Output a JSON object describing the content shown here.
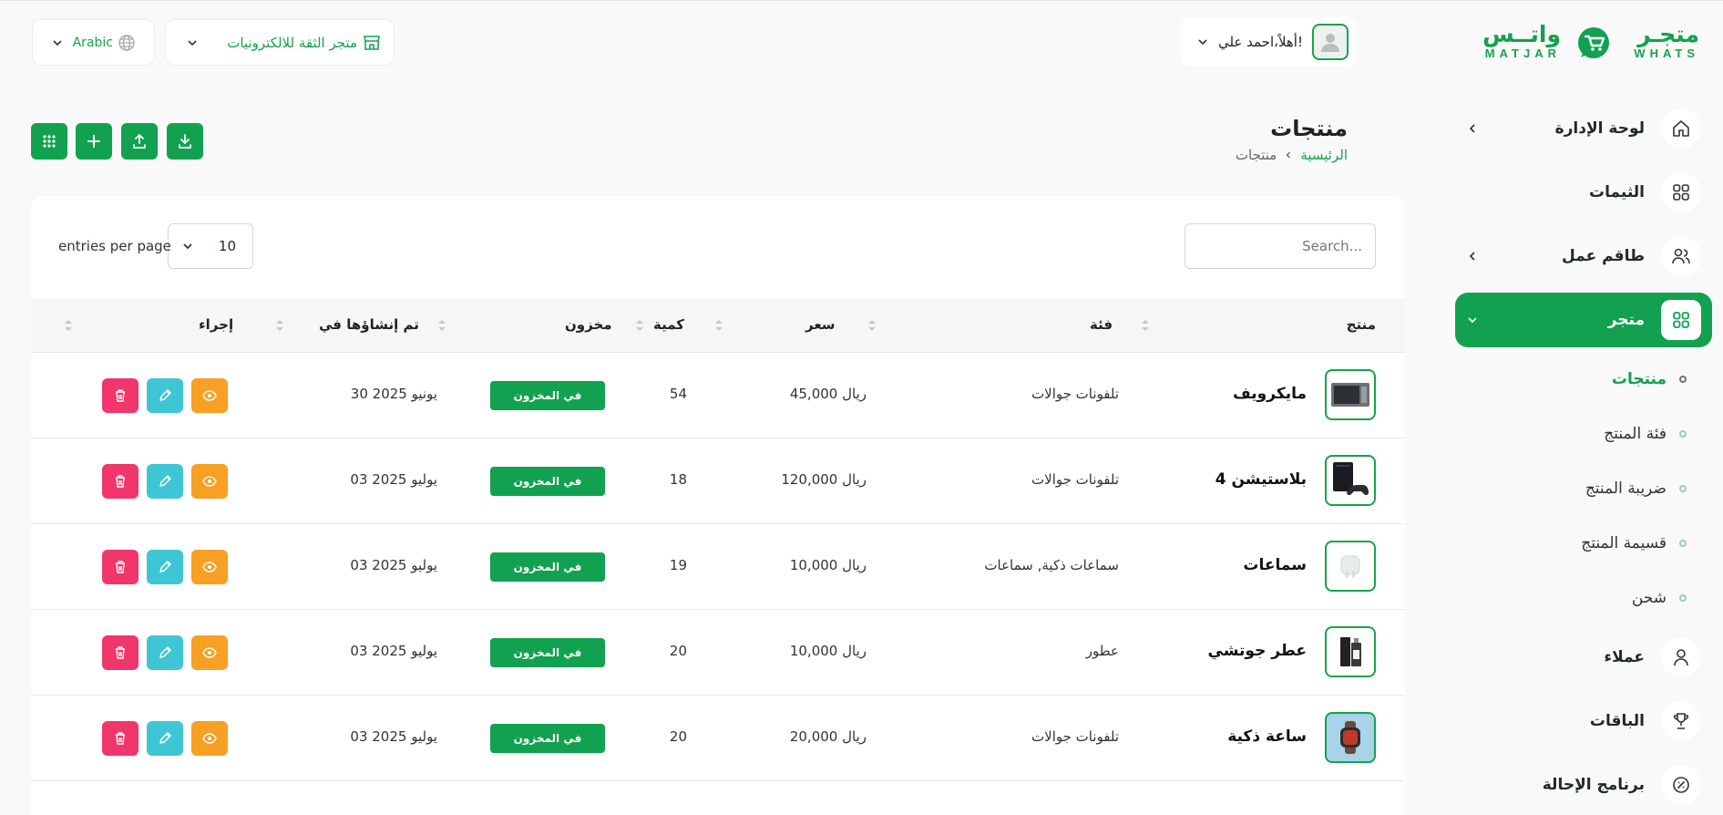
{
  "header": {
    "logo_ar_left": "واتــس",
    "logo_ar_right": "متجـر",
    "logo_en_left": "MATJAR",
    "logo_en_right": "WHATS",
    "greeting": "أهلاً،احمد علي!",
    "store_name": "متجر الثقة للالكترونيات",
    "language": "Arabic"
  },
  "sidebar": {
    "items": [
      {
        "label": "لوحة الإدارة",
        "icon": "home-icon",
        "has_arrow": true
      },
      {
        "label": "الثيمات",
        "icon": "grid-icon",
        "has_arrow": false
      },
      {
        "label": "طاقم عمل",
        "icon": "users-icon",
        "has_arrow": true
      },
      {
        "label": "متجر",
        "icon": "grid-icon",
        "has_arrow": true,
        "active": true
      },
      {
        "label": "عملاء",
        "icon": "user-icon",
        "has_arrow": false
      },
      {
        "label": "الباقات",
        "icon": "trophy-icon",
        "has_arrow": false
      },
      {
        "label": "برنامج الإحالة",
        "icon": "badge-icon",
        "has_arrow": false
      }
    ],
    "sub_items": [
      {
        "label": "منتجات",
        "active": true
      },
      {
        "label": "فئة المنتج"
      },
      {
        "label": "ضريبة المنتج"
      },
      {
        "label": "قسيمة المنتج"
      },
      {
        "label": "شحن"
      }
    ]
  },
  "page": {
    "title": "منتجات",
    "breadcrumb_home": "الرئيسية",
    "breadcrumb_current": "منتجات"
  },
  "table": {
    "search_placeholder": "Search...",
    "per_page_value": "10",
    "per_page_label": "entries per page",
    "columns": [
      "منتج",
      "فئة",
      "سعر",
      "كمية",
      "مخزون",
      "تم إنشاؤها في",
      "إجراء"
    ],
    "rows": [
      {
        "name": "مايكرويف",
        "category": "تلفونات جوالات",
        "price": "45,000 ريال",
        "qty": "54",
        "stock": "في المخزون",
        "created": "30 يونيو 2025"
      },
      {
        "name": "بلاستيشن 4",
        "category": "تلفونات جوالات",
        "price": "120,000 ريال",
        "qty": "18",
        "stock": "في المخزون",
        "created": "03 يوليو 2025"
      },
      {
        "name": "سماعات",
        "category": "سماعات ذكية, سماعات",
        "price": "10,000 ريال",
        "qty": "19",
        "stock": "في المخزون",
        "created": "03 يوليو 2025"
      },
      {
        "name": "عطر جوتشي",
        "category": "عطور",
        "price": "10,000 ريال",
        "qty": "20",
        "stock": "في المخزون",
        "created": "03 يوليو 2025"
      },
      {
        "name": "ساعة ذكية",
        "category": "تلفونات جوالات",
        "price": "20,000 ريال",
        "qty": "20",
        "stock": "في المخزون",
        "created": "03 يوليو 2025"
      }
    ]
  },
  "colors": {
    "accent": "#12a150",
    "view": "#f7a023",
    "edit": "#3fc6d4",
    "delete": "#f0366b"
  }
}
